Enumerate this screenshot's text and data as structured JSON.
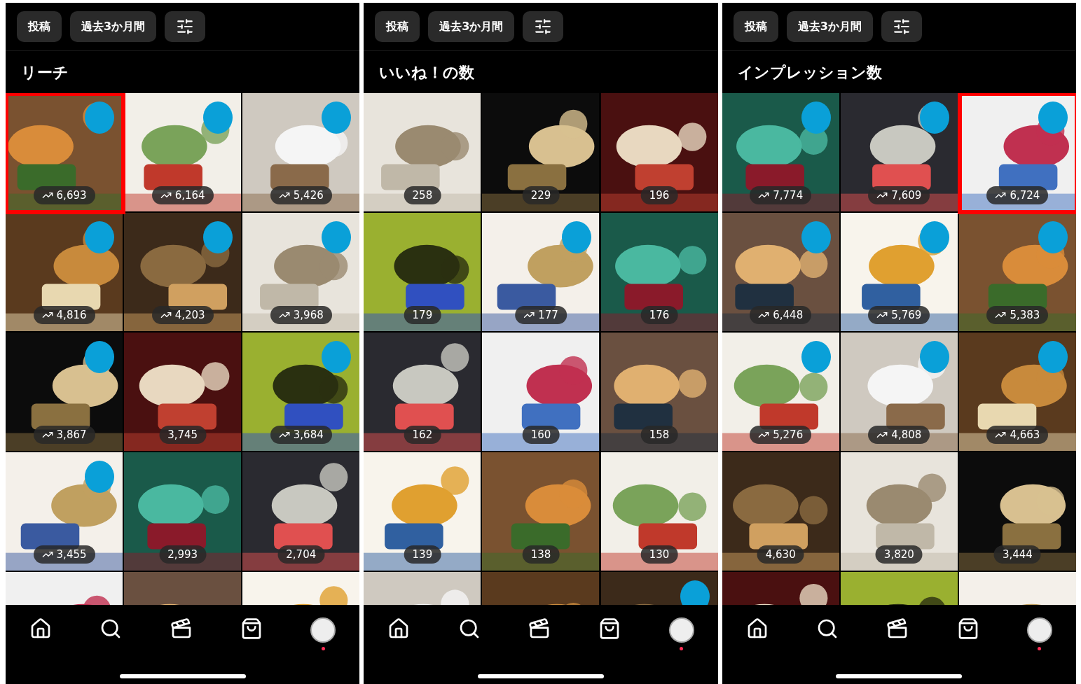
{
  "panels": [
    {
      "filters": [
        {
          "kind": "text",
          "label": "投稿"
        },
        {
          "kind": "text",
          "label": "過去3か月間"
        },
        {
          "kind": "icon"
        }
      ],
      "title": "リーチ",
      "notification": true,
      "cells": [
        {
          "kind": "picture",
          "count": "6,693",
          "trend": true,
          "marker": true,
          "highlighted": true
        },
        {
          "kind": "picture",
          "count": "6,164",
          "trend": true,
          "marker": true,
          "highlighted": false
        },
        {
          "kind": "picture",
          "count": "5,426",
          "trend": true,
          "marker": true,
          "highlighted": false
        },
        {
          "kind": "picture",
          "count": "4,816",
          "trend": true,
          "marker": true,
          "highlighted": false
        },
        {
          "kind": "picture",
          "count": "4,203",
          "trend": true,
          "marker": true,
          "highlighted": false
        },
        {
          "kind": "picture",
          "count": "3,968",
          "trend": true,
          "marker": true,
          "highlighted": false
        },
        {
          "kind": "picture",
          "count": "3,867",
          "trend": true,
          "marker": true,
          "highlighted": false
        },
        {
          "kind": "picture",
          "count": "3,745",
          "trend": false,
          "marker": false,
          "highlighted": false
        },
        {
          "kind": "picture",
          "count": "3,684",
          "trend": true,
          "marker": true,
          "highlighted": false
        },
        {
          "kind": "picture",
          "count": "3,455",
          "trend": true,
          "marker": true,
          "highlighted": false
        },
        {
          "kind": "picture",
          "count": "2,993",
          "trend": false,
          "marker": false,
          "highlighted": false
        },
        {
          "kind": "picture",
          "count": "2,704",
          "trend": false,
          "marker": false,
          "highlighted": false
        },
        {
          "kind": "picture",
          "marker": false,
          "highlighted": false
        },
        {
          "kind": "picture",
          "marker": false,
          "highlighted": false
        },
        {
          "kind": "picture",
          "marker": false,
          "highlighted": false
        }
      ]
    },
    {
      "filters": [
        {
          "kind": "text",
          "label": "投稿"
        },
        {
          "kind": "text",
          "label": "過去3か月間"
        },
        {
          "kind": "icon"
        }
      ],
      "title": "いいね！の数",
      "notification": true,
      "cells": [
        {
          "kind": "picture",
          "count": "258",
          "trend": false,
          "marker": false,
          "highlighted": false
        },
        {
          "kind": "picture",
          "count": "229",
          "trend": false,
          "marker": false,
          "highlighted": false
        },
        {
          "kind": "picture",
          "count": "196",
          "trend": false,
          "marker": false,
          "highlighted": false
        },
        {
          "kind": "picture",
          "count": "179",
          "trend": false,
          "marker": false,
          "highlighted": false
        },
        {
          "kind": "picture",
          "count": "177",
          "trend": true,
          "marker": true,
          "highlighted": false
        },
        {
          "kind": "picture",
          "count": "176",
          "trend": false,
          "marker": false,
          "highlighted": false
        },
        {
          "kind": "picture",
          "count": "162",
          "trend": false,
          "marker": false,
          "highlighted": false
        },
        {
          "kind": "picture",
          "count": "160",
          "trend": false,
          "marker": false,
          "highlighted": false
        },
        {
          "kind": "picture",
          "count": "158",
          "trend": false,
          "marker": false,
          "highlighted": false
        },
        {
          "kind": "picture",
          "count": "139",
          "trend": false,
          "marker": false,
          "highlighted": false
        },
        {
          "kind": "picture",
          "count": "138",
          "trend": false,
          "marker": false,
          "highlighted": false
        },
        {
          "kind": "picture",
          "count": "130",
          "trend": false,
          "marker": false,
          "highlighted": false
        },
        {
          "kind": "picture",
          "marker": false,
          "highlighted": false
        },
        {
          "kind": "picture",
          "marker": false,
          "highlighted": false
        },
        {
          "kind": "picture",
          "marker": true,
          "highlighted": false
        }
      ]
    },
    {
      "filters": [
        {
          "kind": "text",
          "label": "投稿"
        },
        {
          "kind": "text",
          "label": "過去3か月間"
        },
        {
          "kind": "icon"
        }
      ],
      "title": "インプレッション数",
      "notification": true,
      "cells": [
        {
          "kind": "picture",
          "count": "7,774",
          "trend": true,
          "marker": true,
          "highlighted": false
        },
        {
          "kind": "picture",
          "count": "7,609",
          "trend": true,
          "marker": true,
          "highlighted": false
        },
        {
          "kind": "picture",
          "count": "6,724",
          "trend": true,
          "marker": true,
          "highlighted": true
        },
        {
          "kind": "picture",
          "count": "6,448",
          "trend": true,
          "marker": true,
          "highlighted": false
        },
        {
          "kind": "picture",
          "count": "5,769",
          "trend": true,
          "marker": true,
          "highlighted": false
        },
        {
          "kind": "picture",
          "count": "5,383",
          "trend": true,
          "marker": true,
          "highlighted": false
        },
        {
          "kind": "picture",
          "count": "5,276",
          "trend": true,
          "marker": true,
          "highlighted": false
        },
        {
          "kind": "picture",
          "count": "4,808",
          "trend": true,
          "marker": true,
          "highlighted": false
        },
        {
          "kind": "picture",
          "count": "4,663",
          "trend": true,
          "marker": true,
          "highlighted": false
        },
        {
          "kind": "picture",
          "count": "4,630",
          "trend": false,
          "marker": false,
          "highlighted": false
        },
        {
          "kind": "picture",
          "count": "3,820",
          "trend": false,
          "marker": false,
          "highlighted": false
        },
        {
          "kind": "picture",
          "count": "3,444",
          "trend": false,
          "marker": false,
          "highlighted": false
        },
        {
          "kind": "picture",
          "marker": false,
          "highlighted": false
        },
        {
          "kind": "picture",
          "marker": false,
          "highlighted": false
        },
        {
          "kind": "picture",
          "marker": false,
          "highlighted": false
        }
      ]
    }
  ]
}
